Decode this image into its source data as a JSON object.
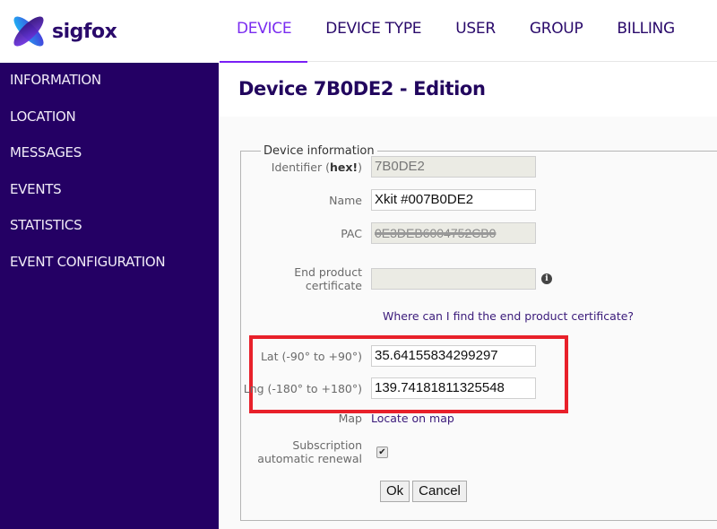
{
  "brand": {
    "name": "sigfox",
    "colors": {
      "primary": "#240064",
      "accent": "#7a1ff5",
      "highlight": "#e8202a"
    }
  },
  "nav": {
    "items": [
      {
        "label": "DEVICE",
        "active": true
      },
      {
        "label": "DEVICE TYPE",
        "active": false
      },
      {
        "label": "USER",
        "active": false
      },
      {
        "label": "GROUP",
        "active": false
      },
      {
        "label": "BILLING",
        "active": false
      }
    ]
  },
  "sidebar": {
    "items": [
      {
        "label": "INFORMATION"
      },
      {
        "label": "LOCATION"
      },
      {
        "label": "MESSAGES"
      },
      {
        "label": "EVENTS"
      },
      {
        "label": "STATISTICS"
      },
      {
        "label": "EVENT CONFIGURATION"
      }
    ]
  },
  "page": {
    "title": "Device 7B0DE2 - Edition"
  },
  "form": {
    "legend": "Device information",
    "identifier": {
      "label_prefix": "Identifier (",
      "label_bold": "hex!",
      "label_suffix": ")",
      "value": "7B0DE2"
    },
    "name": {
      "label": "Name",
      "value": "Xkit #007B0DE2"
    },
    "pac": {
      "label": "PAC",
      "value": "0E3DEB6004752CB0"
    },
    "certificate": {
      "label_line1": "End product",
      "label_line2": "certificate",
      "value": "",
      "info_icon": "info-circle-icon"
    },
    "certificate_help_link": "Where can I find the end product certificate?",
    "lat": {
      "label": "Lat (-90° to +90°)",
      "value": "35.64155834299297"
    },
    "lng": {
      "label": "Lng (-180° to +180°)",
      "value": "139.74181811325548"
    },
    "map": {
      "label": "Map",
      "link": "Locate on map"
    },
    "subscription": {
      "label_line1": "Subscription",
      "label_line2": "automatic renewal",
      "checked": true,
      "check_glyph": "✔"
    },
    "ok_label": "Ok",
    "cancel_label": "Cancel"
  }
}
